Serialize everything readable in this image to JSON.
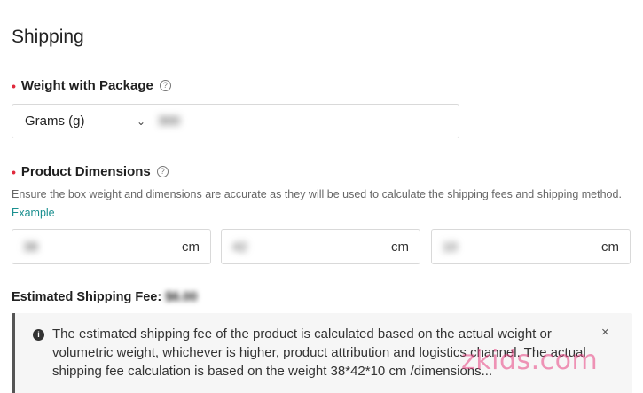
{
  "section": {
    "title": "Shipping"
  },
  "weight": {
    "label": "Weight with Package",
    "unit": "Grams (g)",
    "value": "300"
  },
  "dimensions": {
    "label": "Product Dimensions",
    "hint": "Ensure the box weight and dimensions are accurate as they will be used to calculate the shipping fees and shipping method.",
    "example_link": "Example",
    "fields": [
      {
        "value": "38",
        "unit": "cm"
      },
      {
        "value": "42",
        "unit": "cm"
      },
      {
        "value": "10",
        "unit": "cm"
      }
    ]
  },
  "fee": {
    "label": "Estimated Shipping Fee:",
    "amount": "$6.00"
  },
  "notice": {
    "text": "The estimated shipping fee of the product is calculated based on the actual weight or volumetric weight, whichever is higher, product attribution and logistics channel. The actual shipping fee calculation is based on the weight 38*42*10 cm /dimensions...",
    "close": "×"
  },
  "watermark": "zkids.com",
  "colors": {
    "required": "#e0293c",
    "link": "#1a8f8f",
    "watermark": "#e7407f"
  }
}
